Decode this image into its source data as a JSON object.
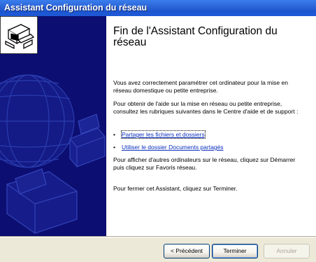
{
  "window": {
    "title": "Assistant Configuration du réseau"
  },
  "content": {
    "heading": "Fin de l'Assistant Configuration du réseau",
    "paragraph1": "Vous avez correctement paramétrer cet ordinateur pour la mise en réseau domestique ou petite entreprise.",
    "paragraph2": "Pour obtenir de l'aide sur la mise en réseau ou petite entreprise, consultez les rubriques suivantes dans le Centre d'aide et de support :",
    "links": [
      {
        "label": "Partager les fichiers et dossiers"
      },
      {
        "label": "Utiliser le dossier Documents partagés"
      }
    ],
    "paragraph3": "Pour afficher d'autres ordinateurs sur le réseau, cliquez sur Démarrer puis cliquez sur Favoris réseau.",
    "paragraph4": "Pour fermer cet Assistant, cliquez sur Terminer."
  },
  "buttons": {
    "back": "< Précédent",
    "finish": "Terminer",
    "cancel": "Annuler",
    "cancel_disabled": true
  },
  "icons": {
    "wizard": "network-computer-icon",
    "sidebar_art": [
      "globe-icon",
      "printer-icon",
      "fax-icon"
    ]
  },
  "colors": {
    "titlebar": "#2a63d6",
    "sidebar": "#0c0e72",
    "link": "#0a2ebd"
  }
}
